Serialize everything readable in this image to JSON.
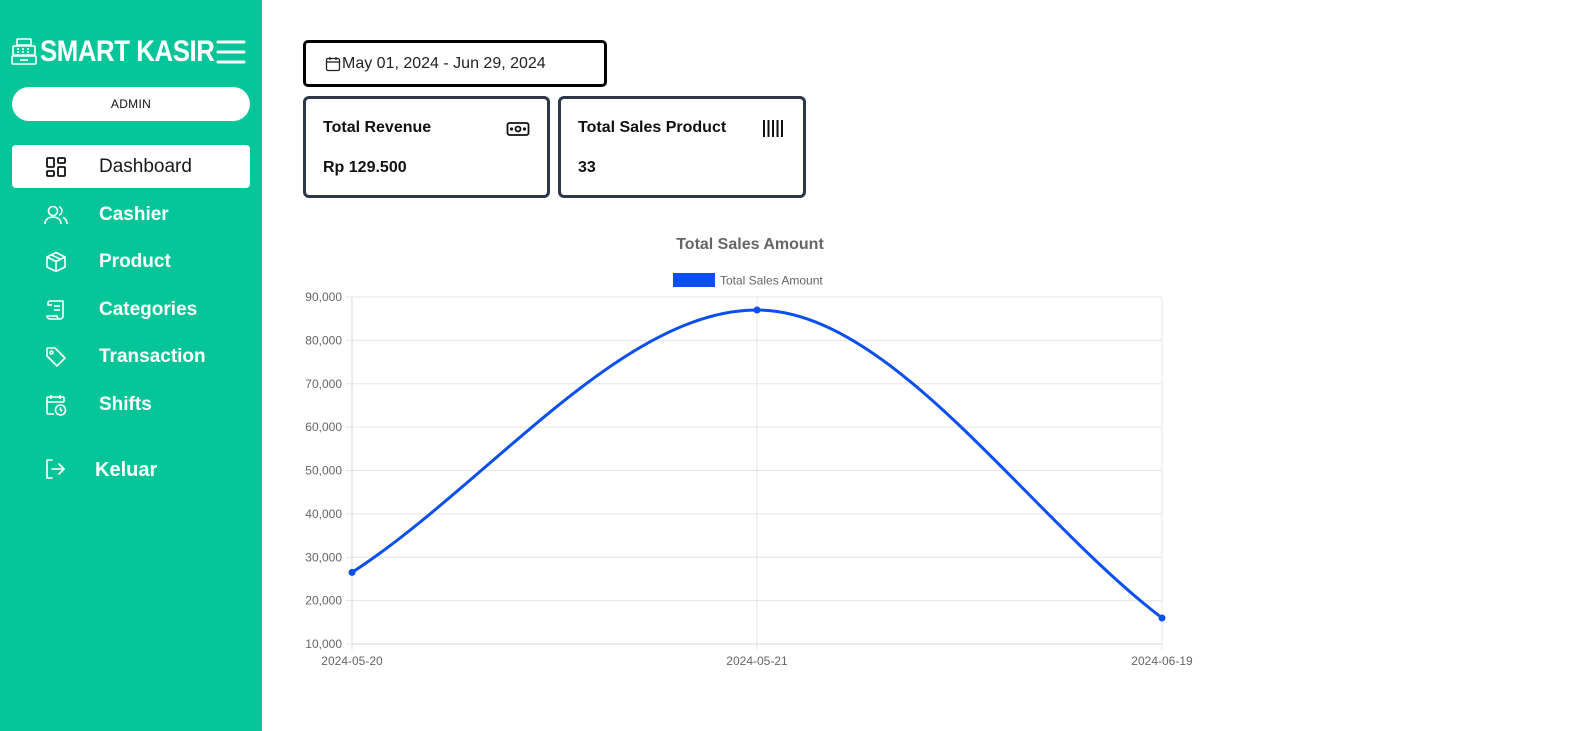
{
  "app": {
    "brand": "SMART KASIR",
    "role": "ADMIN"
  },
  "sidebar": {
    "items": [
      {
        "label": "Dashboard",
        "icon": "dashboard-grid-icon",
        "active": true
      },
      {
        "label": "Cashier",
        "icon": "users-icon",
        "active": false
      },
      {
        "label": "Product",
        "icon": "box-icon",
        "active": false
      },
      {
        "label": "Categories",
        "icon": "scroll-icon",
        "active": false
      },
      {
        "label": "Transaction",
        "icon": "tag-icon",
        "active": false
      },
      {
        "label": "Shifts",
        "icon": "calendar-clock-icon",
        "active": false
      }
    ],
    "logout": "Keluar"
  },
  "filter": {
    "date_range": "May 01, 2024 - Jun 29, 2024"
  },
  "cards": {
    "revenue": {
      "title": "Total Revenue",
      "value": "Rp 129.500",
      "icon": "cash-icon"
    },
    "sales": {
      "title": "Total Sales Product",
      "value": "33",
      "icon": "barcode-icon"
    }
  },
  "colors": {
    "sidebar": "#06c699",
    "series": "#0b4ff0",
    "card_border": "#2d3748"
  },
  "chart_data": {
    "type": "line",
    "title": "Total Sales Amount",
    "categories": [
      "2024-05-20",
      "2024-05-21",
      "2024-06-19"
    ],
    "series": [
      {
        "name": "Total Sales Amount",
        "values": [
          26500,
          87000,
          16000
        ]
      }
    ],
    "ylim": [
      10000,
      90000
    ],
    "yticks": [
      "10,000",
      "20,000",
      "30,000",
      "40,000",
      "50,000",
      "60,000",
      "70,000",
      "80,000",
      "90,000"
    ],
    "grid": true,
    "legend": "top-center",
    "smooth": true
  }
}
